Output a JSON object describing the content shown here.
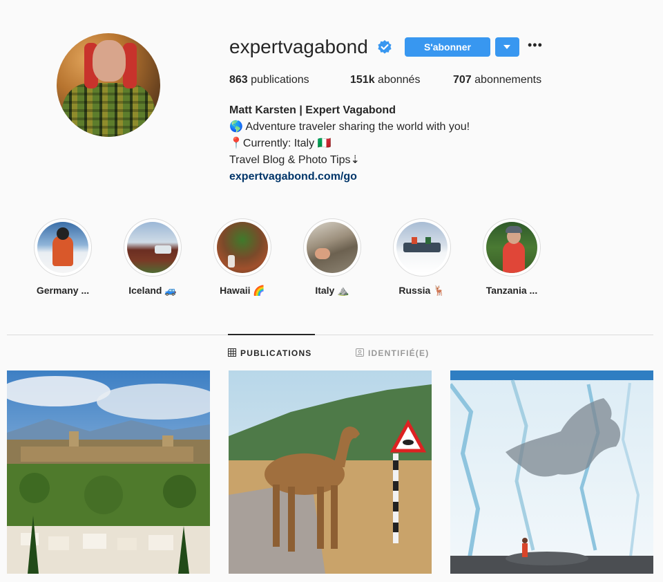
{
  "profile": {
    "username": "expertvagabond",
    "follow_label": "S'abonner",
    "stats": [
      {
        "count": "863",
        "label": "publications"
      },
      {
        "count": "151k",
        "label": "abonnés"
      },
      {
        "count": "707",
        "label": "abonnements"
      }
    ],
    "bio": {
      "name": "Matt Karsten | Expert Vagabond",
      "line1": "🌎 Adventure traveler sharing the world with you!",
      "line2": "📍Currently: Italy 🇮🇹",
      "line3": "Travel Blog & Photo Tips⇣",
      "link": "expertvagabond.com/go"
    }
  },
  "highlights": [
    {
      "label": "Germany ..."
    },
    {
      "label": "Iceland 🚙"
    },
    {
      "label": "Hawaii 🌈"
    },
    {
      "label": "Italy ⛰️"
    },
    {
      "label": "Russia 🦌"
    },
    {
      "label": "Tanzania ..."
    }
  ],
  "tabs": [
    {
      "label": "PUBLICATIONS",
      "active": true,
      "icon": "grid-icon"
    },
    {
      "label": "IDENTIFIÉ(E)",
      "active": false,
      "icon": "tagged-icon"
    }
  ],
  "colors": {
    "accent": "#3897f0",
    "link": "#003569",
    "verified": "#3897f0"
  }
}
